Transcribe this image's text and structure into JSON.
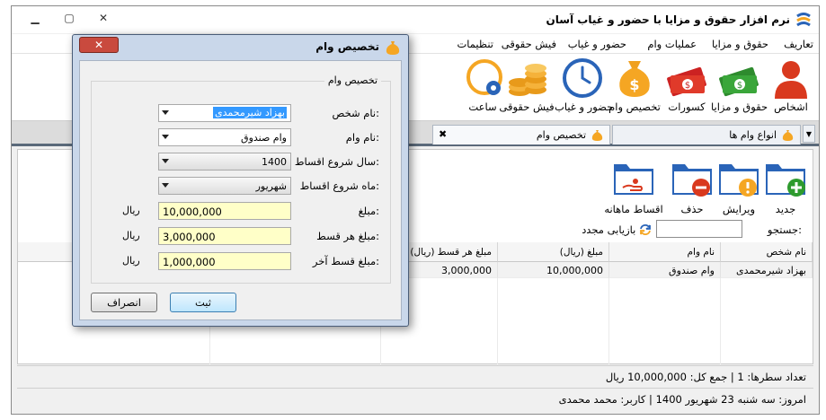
{
  "app": {
    "title": "نرم افزار حقوق و مزایا با حضور و غیاب آسان",
    "colors": {
      "accent": "#f5a623",
      "title_bar": "#ffffff"
    }
  },
  "window_controls": {
    "minimize": "▁",
    "restore": "▢",
    "close": "✕"
  },
  "menu": [
    "تعاریف",
    "حقوق و مزایا",
    "عملیات وام",
    "حضور و غیاب",
    "فیش حقوقی",
    "تنظیمات"
  ],
  "ribbon": [
    {
      "label": "اشخاص",
      "icon": "person-icon"
    },
    {
      "label": "حقوق و مزایا",
      "icon": "money-icon"
    },
    {
      "label": "کسورات",
      "icon": "deduction-icon"
    },
    {
      "label": "تخصیص وام",
      "icon": "money-bag-icon"
    },
    {
      "label": "حضور و غیاب",
      "icon": "clock-icon"
    },
    {
      "label": "فیش حقوقی",
      "icon": "coins-icon"
    },
    {
      "label": "ساعت",
      "icon": "clock-gear-icon"
    }
  ],
  "tabs": [
    {
      "label": "انواع وام ها"
    },
    {
      "label": "تخصیص وام"
    }
  ],
  "tab_close": "✖",
  "tab_scroll": "▼",
  "toolbar": [
    {
      "label": "جدید",
      "icon": "folder-add-icon"
    },
    {
      "label": "ویرایش",
      "icon": "folder-edit-icon"
    },
    {
      "label": "حذف",
      "icon": "folder-delete-icon"
    },
    {
      "label": "اقساط ماهانه",
      "icon": "folder-hand-icon"
    }
  ],
  "search": {
    "label": "جستجو:",
    "value": "",
    "reload": "بازیابی مجدد"
  },
  "grid": {
    "columns": [
      "نام شخص",
      "نام وام",
      "مبلغ (ریال)",
      "مبلغ هر قسط (ریال)"
    ],
    "rows": [
      [
        "بهزاد شیرمحمدی",
        "وام صندوق",
        "10,000,000",
        "3,000,000"
      ]
    ]
  },
  "status": {
    "summary": "تعداد سطرها:  1  |  جمع کل:  10,000,000 ریال",
    "footer": "امروز: سه شنبه 23 شهریور 1400  |  کاربر: محمد محمدی"
  },
  "dialog": {
    "title": "تخصیص وام",
    "close": "✕",
    "group_label": "تخصیص وام",
    "fields": {
      "person": {
        "label": "نام شخص:",
        "value": "بهزاد شیرمحمدی"
      },
      "loan": {
        "label": "نام وام:",
        "value": "وام صندوق"
      },
      "start_year": {
        "label": "سال شروع اقساط:",
        "value": "1400"
      },
      "start_month": {
        "label": "ماه شروع اقساط:",
        "value": "شهریور"
      },
      "amount": {
        "label": "مبلغ:",
        "value": "10,000,000",
        "unit": "ریال"
      },
      "installment": {
        "label": "مبلغ هر قسط:",
        "value": "3,000,000",
        "unit": "ریال"
      },
      "last_installment": {
        "label": "مبلغ قسط آخر:",
        "value": "1,000,000",
        "unit": "ریال"
      }
    },
    "save": "ثبت",
    "cancel": "انصراف"
  }
}
